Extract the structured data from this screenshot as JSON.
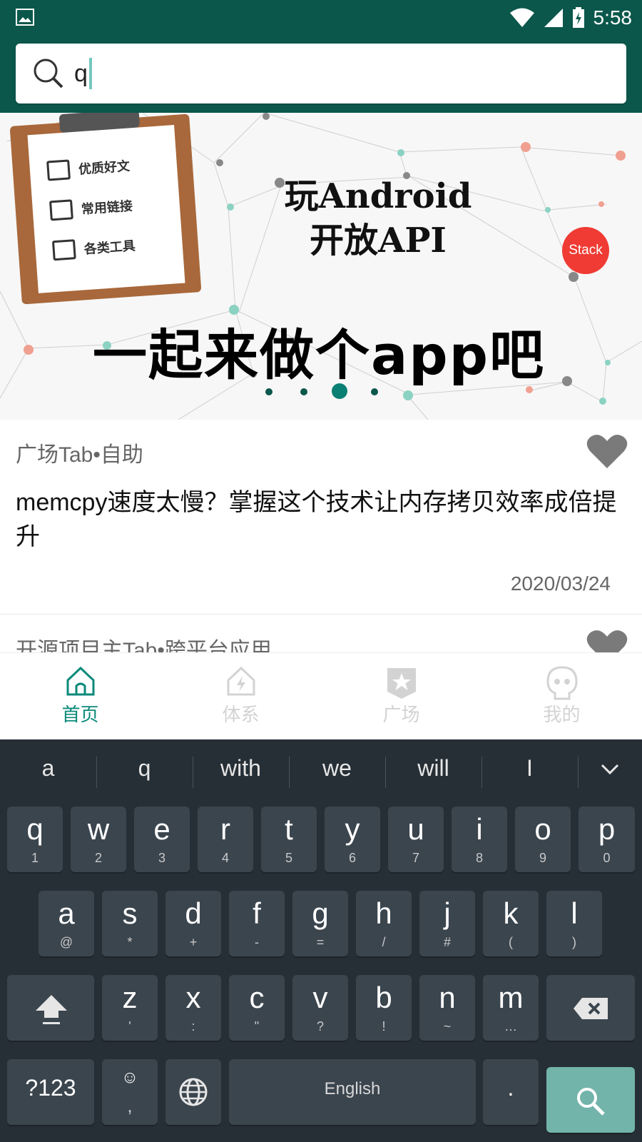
{
  "status_bar": {
    "time": "5:58",
    "icons": [
      "image-icon",
      "wifi-icon",
      "signal-icon",
      "battery-charging-icon"
    ]
  },
  "search": {
    "value": "q",
    "icon": "search-icon"
  },
  "banner": {
    "clipboard_items": [
      "优质好文",
      "常用链接",
      "各类工具"
    ],
    "title_line1": "玩Android",
    "title_line2": "开放API",
    "slogan": "一起来做个app吧",
    "badge": "Stack",
    "indicator_count": 4,
    "active_indicator": 3
  },
  "articles": [
    {
      "meta": "广场Tab•自助",
      "title": "memcpy速度太慢？掌握这个技术让内存拷贝效率成倍提升",
      "date": "2020/03/24",
      "favorite_icon": "heart-icon"
    },
    {
      "meta": "开源项目主Tab•跨平台应用",
      "favorite_icon": "heart-icon"
    }
  ],
  "bottom_nav": {
    "items": [
      {
        "label": "首页",
        "icon": "home-icon",
        "active": true
      },
      {
        "label": "体系",
        "icon": "bolt-house-icon",
        "active": false
      },
      {
        "label": "广场",
        "icon": "star-badge-icon",
        "active": false
      },
      {
        "label": "我的",
        "icon": "face-icon",
        "active": false
      }
    ],
    "active_color": "#0b8a7a",
    "inactive_color": "#d3d3d3"
  },
  "keyboard": {
    "suggestions": [
      "a",
      "q",
      "with",
      "we",
      "will",
      "I"
    ],
    "row1": [
      {
        "main": "q",
        "sub": "1"
      },
      {
        "main": "w",
        "sub": "2"
      },
      {
        "main": "e",
        "sub": "3"
      },
      {
        "main": "r",
        "sub": "4"
      },
      {
        "main": "t",
        "sub": "5"
      },
      {
        "main": "y",
        "sub": "6"
      },
      {
        "main": "u",
        "sub": "7"
      },
      {
        "main": "i",
        "sub": "8"
      },
      {
        "main": "o",
        "sub": "9"
      },
      {
        "main": "p",
        "sub": "0"
      }
    ],
    "row2": [
      {
        "main": "a",
        "sub": "@"
      },
      {
        "main": "s",
        "sub": "*"
      },
      {
        "main": "d",
        "sub": "+"
      },
      {
        "main": "f",
        "sub": "-"
      },
      {
        "main": "g",
        "sub": "="
      },
      {
        "main": "h",
        "sub": "/"
      },
      {
        "main": "j",
        "sub": "#"
      },
      {
        "main": "k",
        "sub": "("
      },
      {
        "main": "l",
        "sub": ")"
      }
    ],
    "row3": [
      {
        "main": "z",
        "sub": "'"
      },
      {
        "main": "x",
        "sub": ":"
      },
      {
        "main": "c",
        "sub": "\""
      },
      {
        "main": "v",
        "sub": "?"
      },
      {
        "main": "b",
        "sub": "!"
      },
      {
        "main": "n",
        "sub": "~"
      },
      {
        "main": "m",
        "sub": "…"
      }
    ],
    "symbols_key": "?123",
    "emoji_sub": ",",
    "space_label": "English",
    "period_key": ".",
    "colors": {
      "background": "#262f36",
      "key": "#3b454e",
      "action": "#72b3aa"
    }
  },
  "colors": {
    "primary": "#0b574b",
    "accent": "#0b8a7a",
    "badge": "#ef3b33"
  }
}
